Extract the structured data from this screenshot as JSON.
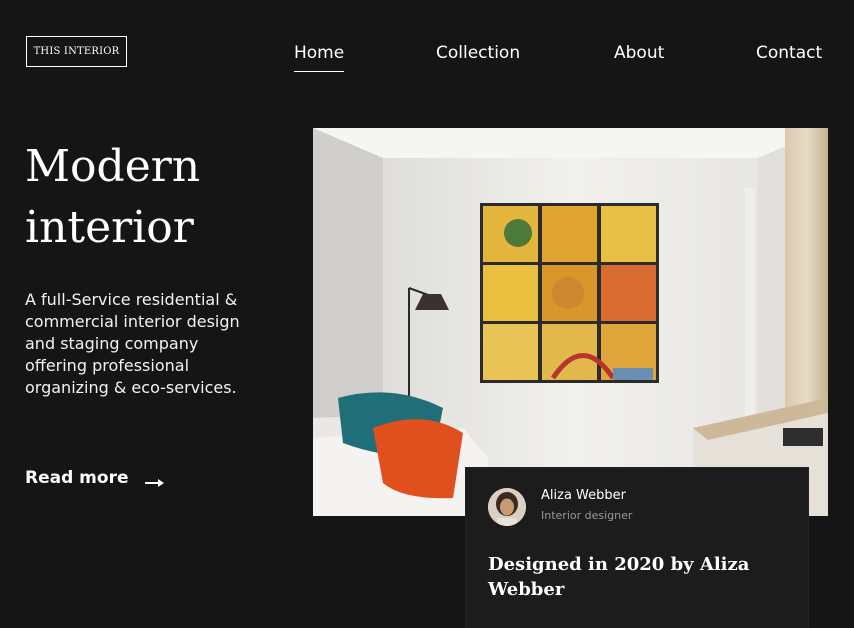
{
  "brand": {
    "logo_text": "THIS INTERIOR"
  },
  "nav": {
    "items": [
      {
        "label": "Home",
        "active": true
      },
      {
        "label": "Collection",
        "active": false
      },
      {
        "label": "About",
        "active": false
      },
      {
        "label": "Contact",
        "active": false
      }
    ]
  },
  "hero": {
    "title_line1": "Modern",
    "title_line2": "interior",
    "description": "A full-Service residential & commercial interior design and staging company offering professional organizing & eco-services.",
    "cta_label": "Read more",
    "cta_icon": "arrow-right-icon",
    "image_icon": "living-room-photo"
  },
  "card": {
    "author_name": "Aliza Webber",
    "author_role": "Interior designer",
    "title": "Designed in 2020 by Aliza Webber",
    "avatar_icon": "avatar-photo"
  },
  "colors": {
    "background": "#151515",
    "card_background": "#1c1c1c",
    "text": "#ffffff",
    "muted_text": "#9a9a9a"
  }
}
